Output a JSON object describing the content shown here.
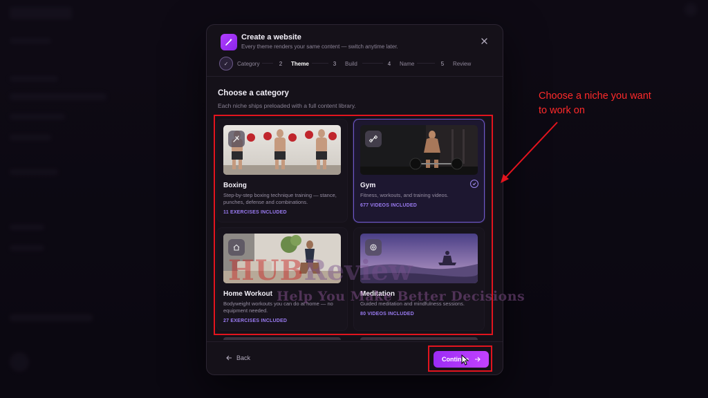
{
  "modal": {
    "title": "Create a website",
    "subtitle": "Every theme renders your same content — switch anytime later.",
    "steps": [
      {
        "num": "✓",
        "label": "Category"
      },
      {
        "num": "2",
        "label": "Theme"
      },
      {
        "num": "3",
        "label": "Build"
      },
      {
        "num": "4",
        "label": "Name"
      },
      {
        "num": "5",
        "label": "Review"
      }
    ],
    "section_title": "Choose a category",
    "section_subtitle": "Each niche ships preloaded with a full content library.",
    "cards": [
      {
        "name": "Boxing",
        "desc": "Step-by-step boxing technique training — stance, punches, defense and combinations.",
        "count": "11 EXERCISES INCLUDED",
        "icon": "boxing-glove-icon"
      },
      {
        "name": "Gym",
        "desc": "Fitness, workouts, and training videos.",
        "count": "677 VIDEOS INCLUDED",
        "icon": "dumbbell-icon",
        "selected": true
      },
      {
        "name": "Home Workout",
        "desc": "Bodyweight workouts you can do at home — no equipment needed.",
        "count": "27 EXERCISES INCLUDED",
        "icon": "home-icon"
      },
      {
        "name": "Meditation",
        "desc": "Guided meditation and mindfulness sessions.",
        "count": "80 VIDEOS INCLUDED",
        "icon": "brain-icon"
      }
    ],
    "back_label": "Back",
    "continue_label": "Continue"
  },
  "annotation": {
    "text": "Choose a niche you want to work on",
    "color": "#e3141e"
  },
  "watermark": {
    "brand_a": "HUB",
    "brand_b": "Review",
    "tagline": "Help You Make Better Decisions"
  },
  "colors": {
    "accent": "#a233f7",
    "selected_border": "#6e57c8",
    "count_text": "#9a7bf2"
  }
}
